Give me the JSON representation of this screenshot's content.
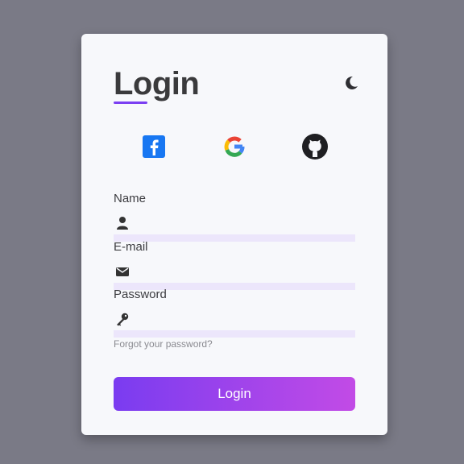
{
  "login": {
    "title": "Login",
    "fields": {
      "name_label": "Name",
      "email_label": "E-mail",
      "password_label": "Password"
    },
    "forgot_text": "Forgot your password?",
    "button_label": "Login"
  },
  "icons": {
    "theme": "moon-icon",
    "social": [
      "facebook-icon",
      "google-icon",
      "github-icon"
    ],
    "fields": [
      "user-icon",
      "envelope-icon",
      "key-icon"
    ]
  },
  "colors": {
    "accent": "#7b3ff2",
    "gradient_start": "#7a3cf0",
    "gradient_end": "#c24be6",
    "input_underline": "#ece6fb",
    "backdrop": "#7a7a86"
  }
}
